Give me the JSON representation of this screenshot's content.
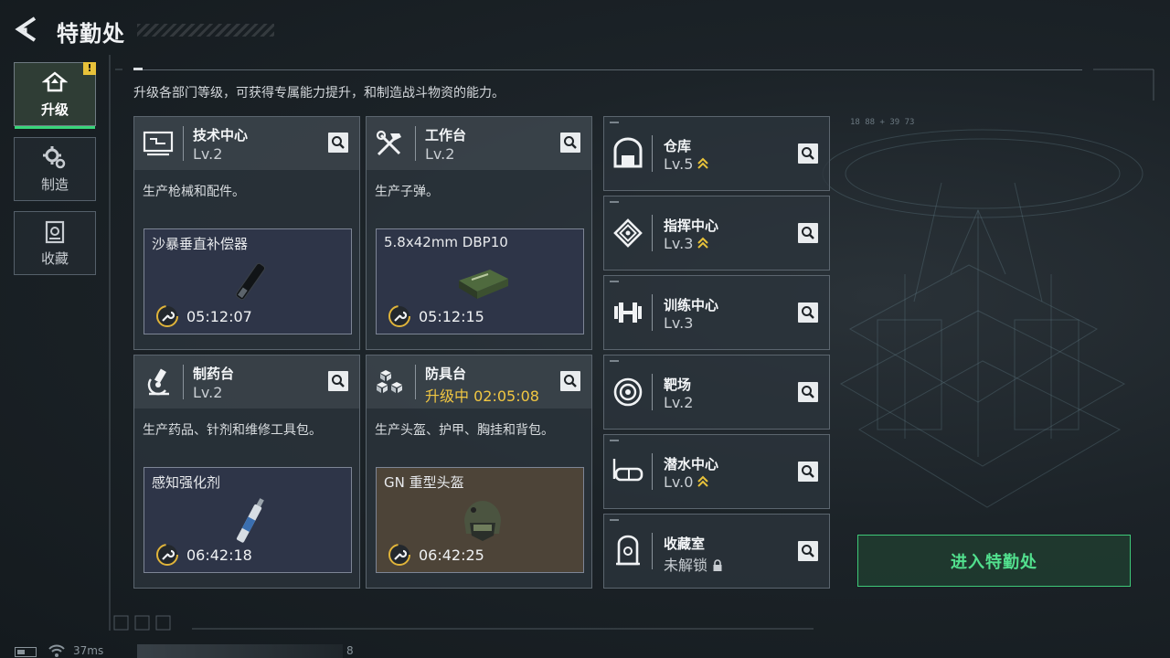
{
  "header": {
    "title": "特勤处"
  },
  "sidebar": {
    "tabs": [
      {
        "label": "升级",
        "icon": "upgrade-icon",
        "active": true,
        "badge": "!"
      },
      {
        "label": "制造",
        "icon": "gears-icon",
        "active": false
      },
      {
        "label": "收藏",
        "icon": "collection-icon",
        "active": false
      }
    ]
  },
  "description": "升级各部门等级，可获得专属能力提升，和制造战斗物资的能力。",
  "stations": [
    {
      "name": "技术中心",
      "level": "Lv.2",
      "icon": "computer-icon",
      "desc": "生产枪械和配件。",
      "craft": {
        "item": "沙暴垂直补偿器",
        "time": "05:12:07",
        "image": "compensator-image"
      }
    },
    {
      "name": "工作台",
      "level": "Lv.2",
      "icon": "tools-icon",
      "desc": "生产子弹。",
      "craft": {
        "item": "5.8x42mm DBP10",
        "time": "05:12:15",
        "image": "ammo-box-image"
      }
    },
    {
      "name": "制药台",
      "level": "Lv.2",
      "icon": "microscope-icon",
      "desc": "生产药品、针剂和维修工具包。",
      "craft": {
        "item": "感知强化剂",
        "time": "06:42:18",
        "image": "injector-image"
      }
    },
    {
      "name": "防具台",
      "level": "升级中 02:05:08",
      "icon": "armor-blocks-icon",
      "desc": "生产头盔、护甲、胸挂和背包。",
      "craft": {
        "item": "GN 重型头盔",
        "time": "06:42:25",
        "image": "helmet-image"
      }
    }
  ],
  "facilities": [
    {
      "name": "仓库",
      "level": "Lv.5",
      "icon": "warehouse-icon",
      "upgradable": true,
      "locked": false
    },
    {
      "name": "指挥中心",
      "level": "Lv.3",
      "icon": "chip-icon",
      "upgradable": true,
      "locked": false
    },
    {
      "name": "训练中心",
      "level": "Lv.3",
      "icon": "dumbbell-icon",
      "upgradable": false,
      "locked": false
    },
    {
      "name": "靶场",
      "level": "Lv.2",
      "icon": "target-icon",
      "upgradable": false,
      "locked": false
    },
    {
      "name": "潜水中心",
      "level": "Lv.0",
      "icon": "diving-mask-icon",
      "upgradable": true,
      "locked": false
    },
    {
      "name": "收藏室",
      "level": "未解锁",
      "icon": "vault-icon",
      "upgradable": false,
      "locked": true
    }
  ],
  "enter_button": "进入特勤处",
  "status": {
    "ping": "37ms",
    "count": "8"
  },
  "colors": {
    "accent_green": "#39d67a",
    "upgrade_gold": "#f1c742",
    "panel": "#2c343c"
  }
}
